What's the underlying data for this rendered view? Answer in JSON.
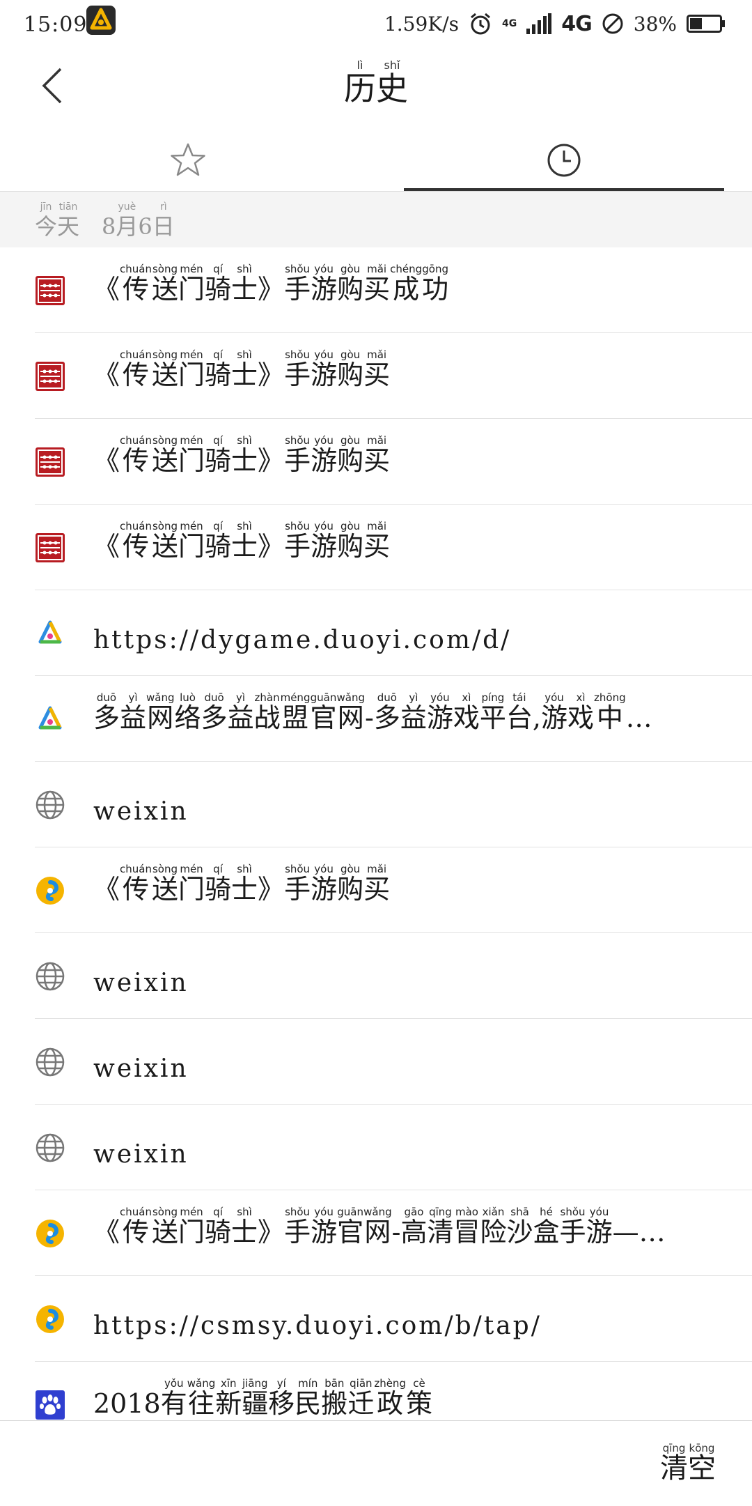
{
  "status_bar": {
    "time": "15:09",
    "net_speed": "1.59K/s",
    "network": "4G",
    "network_small": "4G",
    "battery_pct": "38%"
  },
  "header": {
    "title": [
      {
        "py": "lì",
        "hz": "历"
      },
      {
        "py": "shǐ",
        "hz": "史"
      }
    ]
  },
  "tabs": [
    {
      "icon": "star-icon",
      "active": false
    },
    {
      "icon": "clock-icon",
      "active": true
    }
  ],
  "date_section": {
    "today": [
      {
        "py": "jīn",
        "hz": "今"
      },
      {
        "py": "tiān",
        "hz": "天"
      }
    ],
    "date": [
      {
        "py": "",
        "hz": "8"
      },
      {
        "py": "yuè",
        "hz": "月"
      },
      {
        "py": "",
        "hz": "6"
      },
      {
        "py": "rì",
        "hz": "日"
      }
    ]
  },
  "history": [
    {
      "icon": "abacus-icon",
      "segments": [
        {
          "py": "",
          "hz": "《"
        },
        {
          "py": "chuán",
          "hz": "传"
        },
        {
          "py": "sòng",
          "hz": "送"
        },
        {
          "py": "mén",
          "hz": "门"
        },
        {
          "py": "qí",
          "hz": "骑"
        },
        {
          "py": "shì",
          "hz": "士"
        },
        {
          "py": "",
          "hz": "》"
        },
        {
          "py": "shǒu",
          "hz": "手"
        },
        {
          "py": "yóu",
          "hz": "游"
        },
        {
          "py": "gòu",
          "hz": "购"
        },
        {
          "py": "mǎi",
          "hz": "买"
        },
        {
          "py": "chéng",
          "hz": "成"
        },
        {
          "py": "gōng",
          "hz": "功"
        }
      ]
    },
    {
      "icon": "abacus-icon",
      "segments": [
        {
          "py": "",
          "hz": "《"
        },
        {
          "py": "chuán",
          "hz": "传"
        },
        {
          "py": "sòng",
          "hz": "送"
        },
        {
          "py": "mén",
          "hz": "门"
        },
        {
          "py": "qí",
          "hz": "骑"
        },
        {
          "py": "shì",
          "hz": "士"
        },
        {
          "py": "",
          "hz": "》"
        },
        {
          "py": "shǒu",
          "hz": "手"
        },
        {
          "py": "yóu",
          "hz": "游"
        },
        {
          "py": "gòu",
          "hz": "购"
        },
        {
          "py": "mǎi",
          "hz": "买"
        }
      ]
    },
    {
      "icon": "abacus-icon",
      "segments": [
        {
          "py": "",
          "hz": "《"
        },
        {
          "py": "chuán",
          "hz": "传"
        },
        {
          "py": "sòng",
          "hz": "送"
        },
        {
          "py": "mén",
          "hz": "门"
        },
        {
          "py": "qí",
          "hz": "骑"
        },
        {
          "py": "shì",
          "hz": "士"
        },
        {
          "py": "",
          "hz": "》"
        },
        {
          "py": "shǒu",
          "hz": "手"
        },
        {
          "py": "yóu",
          "hz": "游"
        },
        {
          "py": "gòu",
          "hz": "购"
        },
        {
          "py": "mǎi",
          "hz": "买"
        }
      ]
    },
    {
      "icon": "abacus-icon",
      "segments": [
        {
          "py": "",
          "hz": "《"
        },
        {
          "py": "chuán",
          "hz": "传"
        },
        {
          "py": "sòng",
          "hz": "送"
        },
        {
          "py": "mén",
          "hz": "门"
        },
        {
          "py": "qí",
          "hz": "骑"
        },
        {
          "py": "shì",
          "hz": "士"
        },
        {
          "py": "",
          "hz": "》"
        },
        {
          "py": "shǒu",
          "hz": "手"
        },
        {
          "py": "yóu",
          "hz": "游"
        },
        {
          "py": "gòu",
          "hz": "购"
        },
        {
          "py": "mǎi",
          "hz": "买"
        }
      ]
    },
    {
      "icon": "duoyi-logo-icon",
      "plain": "https://dygame.duoyi.com/d/"
    },
    {
      "icon": "duoyi-logo-icon",
      "segments": [
        {
          "py": "duō",
          "hz": "多"
        },
        {
          "py": "yì",
          "hz": "益"
        },
        {
          "py": "wǎng",
          "hz": "网"
        },
        {
          "py": "luò",
          "hz": "络"
        },
        {
          "py": "duō",
          "hz": "多"
        },
        {
          "py": "yì",
          "hz": "益"
        },
        {
          "py": "zhàn",
          "hz": "战"
        },
        {
          "py": "méng",
          "hz": "盟"
        },
        {
          "py": "guān",
          "hz": "官"
        },
        {
          "py": "wǎng",
          "hz": "网"
        },
        {
          "py": "",
          "hz": "-"
        },
        {
          "py": "duō",
          "hz": "多"
        },
        {
          "py": "yì",
          "hz": "益"
        },
        {
          "py": "yóu",
          "hz": "游"
        },
        {
          "py": "xì",
          "hz": "戏"
        },
        {
          "py": "píng",
          "hz": "平"
        },
        {
          "py": "tái",
          "hz": "台"
        },
        {
          "py": "",
          "hz": ","
        },
        {
          "py": "yóu",
          "hz": "游"
        },
        {
          "py": "xì",
          "hz": "戏"
        },
        {
          "py": "zhōng",
          "hz": "中"
        },
        {
          "py": "",
          "hz": "…"
        }
      ]
    },
    {
      "icon": "globe-icon",
      "plain": "weixin"
    },
    {
      "icon": "swirl-icon",
      "segments": [
        {
          "py": "",
          "hz": "《"
        },
        {
          "py": "chuán",
          "hz": "传"
        },
        {
          "py": "sòng",
          "hz": "送"
        },
        {
          "py": "mén",
          "hz": "门"
        },
        {
          "py": "qí",
          "hz": "骑"
        },
        {
          "py": "shì",
          "hz": "士"
        },
        {
          "py": "",
          "hz": "》"
        },
        {
          "py": "shǒu",
          "hz": "手"
        },
        {
          "py": "yóu",
          "hz": "游"
        },
        {
          "py": "gòu",
          "hz": "购"
        },
        {
          "py": "mǎi",
          "hz": "买"
        }
      ]
    },
    {
      "icon": "globe-icon",
      "plain": "weixin"
    },
    {
      "icon": "globe-icon",
      "plain": "weixin"
    },
    {
      "icon": "globe-icon",
      "plain": "weixin"
    },
    {
      "icon": "swirl-icon",
      "segments": [
        {
          "py": "",
          "hz": "《"
        },
        {
          "py": "chuán",
          "hz": "传"
        },
        {
          "py": "sòng",
          "hz": "送"
        },
        {
          "py": "mén",
          "hz": "门"
        },
        {
          "py": "qí",
          "hz": "骑"
        },
        {
          "py": "shì",
          "hz": "士"
        },
        {
          "py": "",
          "hz": "》"
        },
        {
          "py": "shǒu",
          "hz": "手"
        },
        {
          "py": "yóu",
          "hz": "游"
        },
        {
          "py": "guān",
          "hz": "官"
        },
        {
          "py": "wǎng",
          "hz": "网"
        },
        {
          "py": "",
          "hz": "-"
        },
        {
          "py": "gāo",
          "hz": "高"
        },
        {
          "py": "qīng",
          "hz": "清"
        },
        {
          "py": "mào",
          "hz": "冒"
        },
        {
          "py": "xiǎn",
          "hz": "险"
        },
        {
          "py": "shā",
          "hz": "沙"
        },
        {
          "py": "hé",
          "hz": "盒"
        },
        {
          "py": "shǒu",
          "hz": "手"
        },
        {
          "py": "yóu",
          "hz": "游"
        },
        {
          "py": "",
          "hz": "—…"
        }
      ]
    },
    {
      "icon": "swirl-icon",
      "plain": "https://csmsy.duoyi.com/b/tap/"
    },
    {
      "icon": "paw-icon",
      "segments": [
        {
          "py": "",
          "hz": "2018"
        },
        {
          "py": "yǒu",
          "hz": "有"
        },
        {
          "py": "wǎng",
          "hz": "往"
        },
        {
          "py": "xīn",
          "hz": "新"
        },
        {
          "py": "jiāng",
          "hz": "疆"
        },
        {
          "py": "yí",
          "hz": "移"
        },
        {
          "py": "mín",
          "hz": "民"
        },
        {
          "py": "bān",
          "hz": "搬"
        },
        {
          "py": "qiān",
          "hz": "迁"
        },
        {
          "py": "zhèng",
          "hz": "政"
        },
        {
          "py": "cè",
          "hz": "策"
        }
      ]
    }
  ],
  "bottom_bar": {
    "clear": [
      {
        "py": "qīng",
        "hz": "清"
      },
      {
        "py": "kōng",
        "hz": "空"
      }
    ]
  }
}
